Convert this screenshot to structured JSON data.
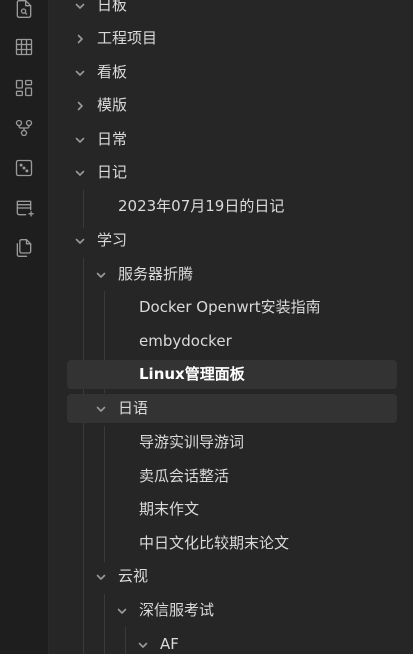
{
  "ribbon": {
    "icons": [
      "file-search-icon",
      "table-icon",
      "dashboard-icon",
      "git-fork-icon",
      "dice-icon",
      "new-canvas-icon",
      "copy-files-icon"
    ]
  },
  "tree": {
    "items": [
      {
        "label": "日板",
        "expanded": true,
        "chevron": "down"
      },
      {
        "label": "工程项目",
        "expanded": false,
        "chevron": "right"
      },
      {
        "label": "看板",
        "expanded": true,
        "chevron": "down"
      },
      {
        "label": "模版",
        "expanded": false,
        "chevron": "right"
      },
      {
        "label": "日常",
        "expanded": true,
        "chevron": "down"
      },
      {
        "label": "日记",
        "expanded": true,
        "chevron": "down"
      },
      {
        "label": "2023年07月19日的日记"
      },
      {
        "label": "学习",
        "expanded": true,
        "chevron": "down"
      },
      {
        "label": "服务器折腾",
        "expanded": true,
        "chevron": "down"
      },
      {
        "label": "Docker Openwrt安装指南"
      },
      {
        "label": "embydocker"
      },
      {
        "label": "Linux管理面板",
        "active": true
      },
      {
        "label": "日语",
        "expanded": true,
        "chevron": "down"
      },
      {
        "label": "导游实训导游词"
      },
      {
        "label": "卖瓜会话整活"
      },
      {
        "label": "期末作文"
      },
      {
        "label": "中日文化比较期末论文"
      },
      {
        "label": "云视",
        "expanded": true,
        "chevron": "down"
      },
      {
        "label": "深信服考试",
        "expanded": true,
        "chevron": "down"
      },
      {
        "label": "AF",
        "expanded": true,
        "chevron": "down"
      }
    ]
  }
}
